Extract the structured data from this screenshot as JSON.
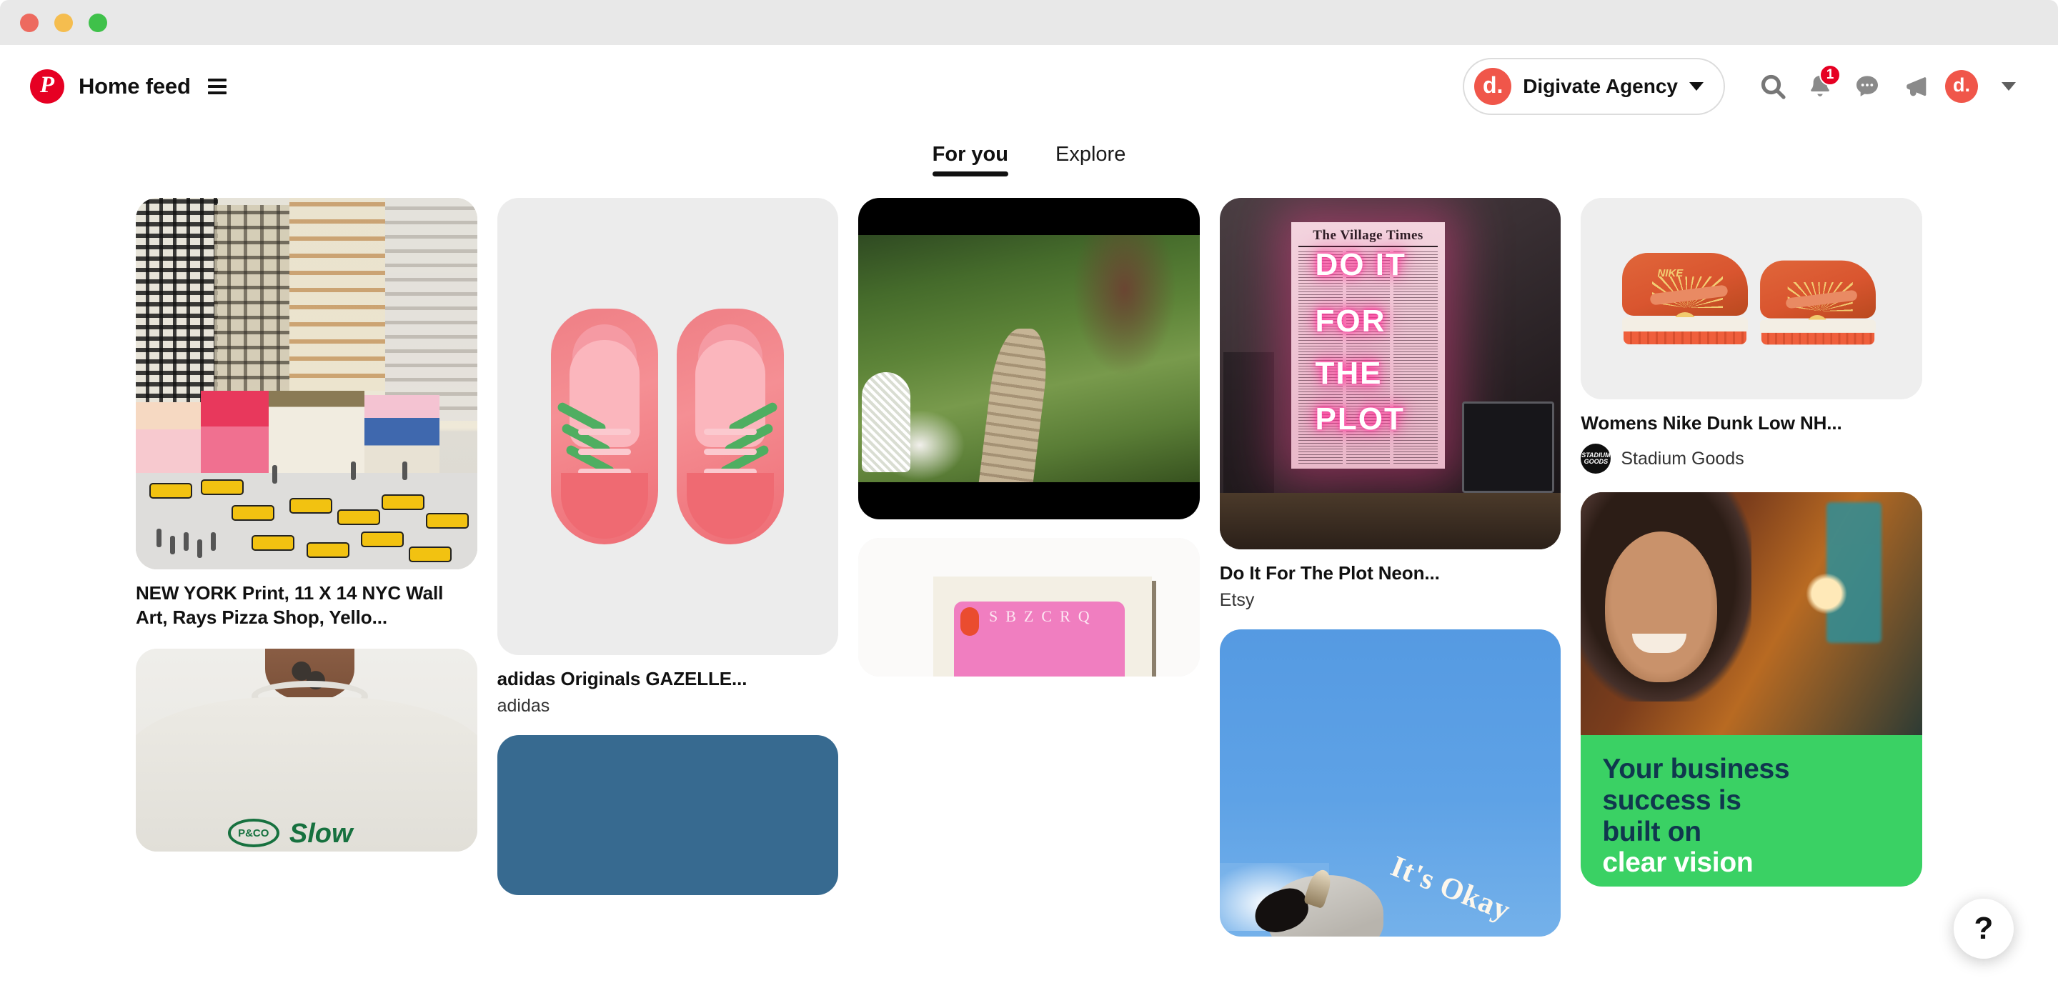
{
  "window": {
    "controls": [
      "close",
      "minimize",
      "zoom"
    ]
  },
  "header": {
    "logo_icon": "pinterest-logo-icon",
    "logo_glyph": "P",
    "title": "Home feed",
    "menu_icon": "hamburger-menu-icon",
    "account_switcher": {
      "avatar_glyph": "d.",
      "name": "Digivate Agency",
      "chevron_icon": "chevron-down-icon"
    },
    "actions": [
      {
        "name": "search-icon",
        "label": "Search",
        "badge": ""
      },
      {
        "name": "notifications-bell-icon",
        "label": "Notifications",
        "badge": "1"
      },
      {
        "name": "messages-chat-icon",
        "label": "Messages",
        "badge": ""
      },
      {
        "name": "ads-megaphone-icon",
        "label": "Ads",
        "badge": ""
      }
    ],
    "user_avatar_glyph": "d.",
    "account_menu_chevron": "chevron-down-icon",
    "accent_color": "#e60023",
    "badge_color": "#e60023"
  },
  "tabs": [
    {
      "label": "For you",
      "active": true
    },
    {
      "label": "Explore",
      "active": false
    }
  ],
  "feed": {
    "columns": [
      {
        "pins": [
          {
            "name": "pin-nyc-print",
            "art": "nyc",
            "title": "NEW YORK Print, 11 X 14 NYC Wall Art, Rays Pizza Shop, Yello...",
            "source": "",
            "attribution": ""
          },
          {
            "name": "pin-slow-sundays-sweatshirt",
            "art": "sweat",
            "title": "",
            "source": "",
            "attribution": ""
          }
        ]
      },
      {
        "pins": [
          {
            "name": "pin-adidas-gazelle",
            "art": "adidas",
            "title": "adidas Originals GAZELLE...",
            "source": "adidas",
            "attribution": ""
          },
          {
            "name": "pin-blue-card",
            "art": "blue",
            "title": "",
            "source": "",
            "attribution": ""
          }
        ]
      },
      {
        "pins": [
          {
            "name": "pin-garden-path",
            "art": "garden",
            "title": "",
            "source": "",
            "attribution": ""
          },
          {
            "name": "pin-alphabet-card",
            "art": "letters",
            "title": "",
            "source": "",
            "attribution": "",
            "letters": [
              "S",
              "B",
              "Z",
              "C",
              "R",
              "Q"
            ]
          }
        ]
      },
      {
        "pins": [
          {
            "name": "pin-do-it-for-the-plot-neon",
            "art": "neon",
            "title": "Do It For The Plot Neon...",
            "source": "Etsy",
            "attribution": "",
            "poster_masthead": "The Village Times",
            "neon_words": [
              "DO IT",
              "FOR",
              "THE",
              "PLOT"
            ]
          },
          {
            "name": "pin-its-okay-cow",
            "art": "skycow",
            "title": "",
            "source": "",
            "attribution": "",
            "overlay_text": "It's Okay"
          }
        ]
      },
      {
        "pins": [
          {
            "name": "pin-nike-dunk-low",
            "art": "nike",
            "title": "Womens Nike Dunk Low NH...",
            "source": "",
            "attribution": "Stadium Goods",
            "attribution_avatar_lines": [
              "STADIUM",
              "GOODS"
            ],
            "brand_word": "NIKE"
          },
          {
            "name": "pin-business-success-ad",
            "art": "woman",
            "title": "",
            "source": "",
            "attribution": "",
            "ad_lines": [
              "Your business",
              "success is",
              "built on",
              "clear vision"
            ],
            "ad_highlight_line": "clear vision",
            "ad_bg_color": "#3ad164",
            "ad_text_color": "#10374e"
          }
        ]
      }
    ]
  },
  "help": {
    "name": "help-button",
    "glyph": "?"
  }
}
